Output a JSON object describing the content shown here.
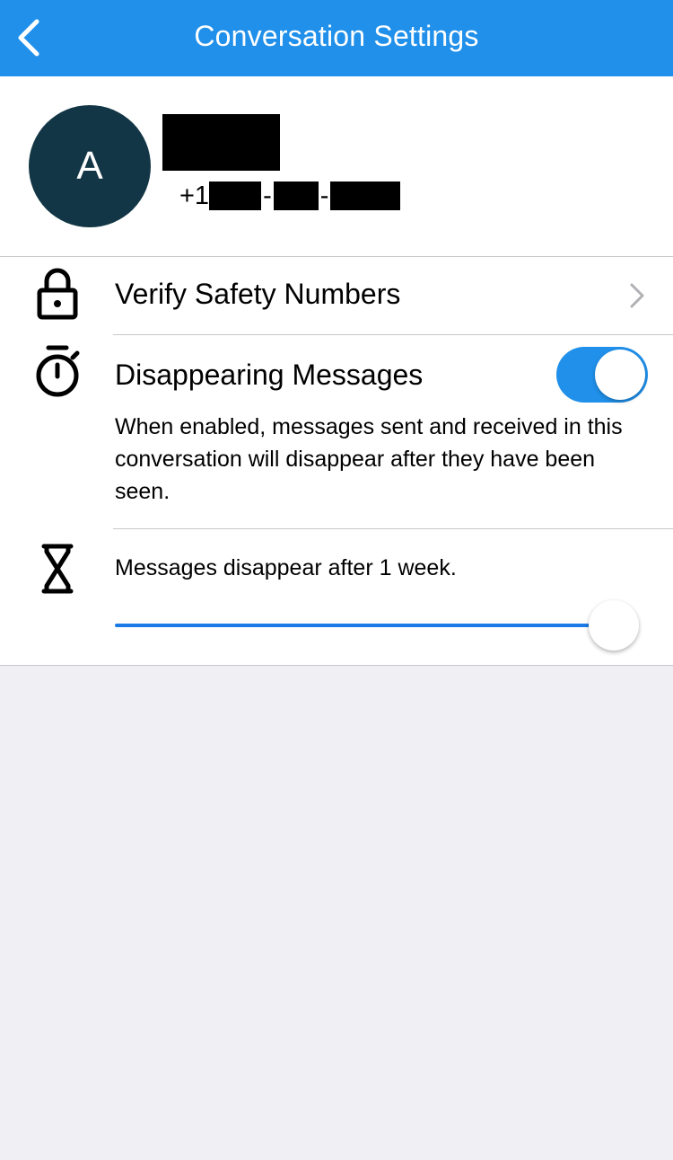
{
  "navbar": {
    "title": "Conversation Settings",
    "back_icon": "chevron-left-icon"
  },
  "contact": {
    "avatar_initial": "A",
    "avatar_color": "#123645",
    "phone_prefix": "+1"
  },
  "rows": {
    "verify": {
      "label": "Verify Safety Numbers",
      "icon": "lock-icon"
    },
    "disappearing": {
      "label": "Disappearing Messages",
      "icon": "stopwatch-icon",
      "enabled": true,
      "description": "When enabled, messages sent and received in this conversation will disappear after they have been seen."
    },
    "timer": {
      "icon": "hourglass-icon",
      "label": "Messages disappear after 1 week.",
      "slider_value": 1.0
    }
  },
  "colors": {
    "accent": "#2090ea",
    "slider_accent": "#1c7ae6"
  }
}
